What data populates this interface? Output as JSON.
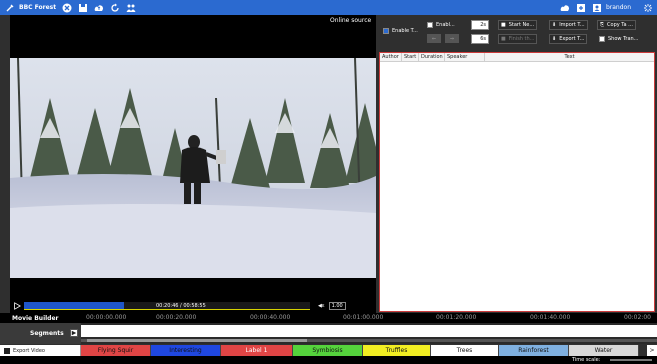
{
  "topbar": {
    "app_name": "BBC Forest",
    "icons": [
      "tool-icon",
      "close-icon",
      "save-icon",
      "cloud-upload-icon",
      "refresh-icon",
      "people-icon"
    ],
    "user_name": "brandon"
  },
  "video": {
    "source_label": "Online source",
    "time": "00:20:46 / 00:58:55",
    "progress": 0.35,
    "rate": "1.00",
    "volume_icon": "volume-icon"
  },
  "transcript": {
    "enable_transcript": "Enable T...",
    "enable_auto": "Enabl...",
    "spin_top": "2s",
    "spin_bottom": "6s",
    "start_new": "Start Ne...",
    "finish": "Finish th...",
    "import": "Import T...",
    "export": "Export T...",
    "copy": "Copy Ta ...",
    "show": "Show Tran...",
    "columns": [
      "Author",
      "Start",
      "Duration",
      "Speaker",
      "Text"
    ]
  },
  "movie_builder": {
    "title": "Movie Builder",
    "ticks": [
      "00:00:00.000",
      "00:00:20.000",
      "00:00:40.000",
      "00:01:00.000",
      "00:01:20.000",
      "00:01:40.000",
      "00:02:00"
    ]
  },
  "segments": {
    "label": "Segments"
  },
  "labels_bar": {
    "export_label": "Export Video",
    "items": [
      {
        "name": "Flying Squir",
        "color": "#e04545",
        "text_color": "#111"
      },
      {
        "name": "Interesting",
        "color": "#1f47e0",
        "text_color": "#111"
      },
      {
        "name": "Label 1",
        "color": "#e04545",
        "text_color": "#fff"
      },
      {
        "name": "Symbiosis",
        "color": "#55d33c",
        "text_color": "#111"
      },
      {
        "name": "Truffles",
        "color": "#f2ee22",
        "text_color": "#111"
      },
      {
        "name": "Trees",
        "color": "#ffffff",
        "text_color": "#111"
      },
      {
        "name": "Rainforest",
        "color": "#7fb0e0",
        "text_color": "#111"
      },
      {
        "name": "Water",
        "color": "#d8d8d8",
        "text_color": "#111"
      }
    ]
  },
  "bottom": {
    "time_scale_label": "Time scale:"
  }
}
